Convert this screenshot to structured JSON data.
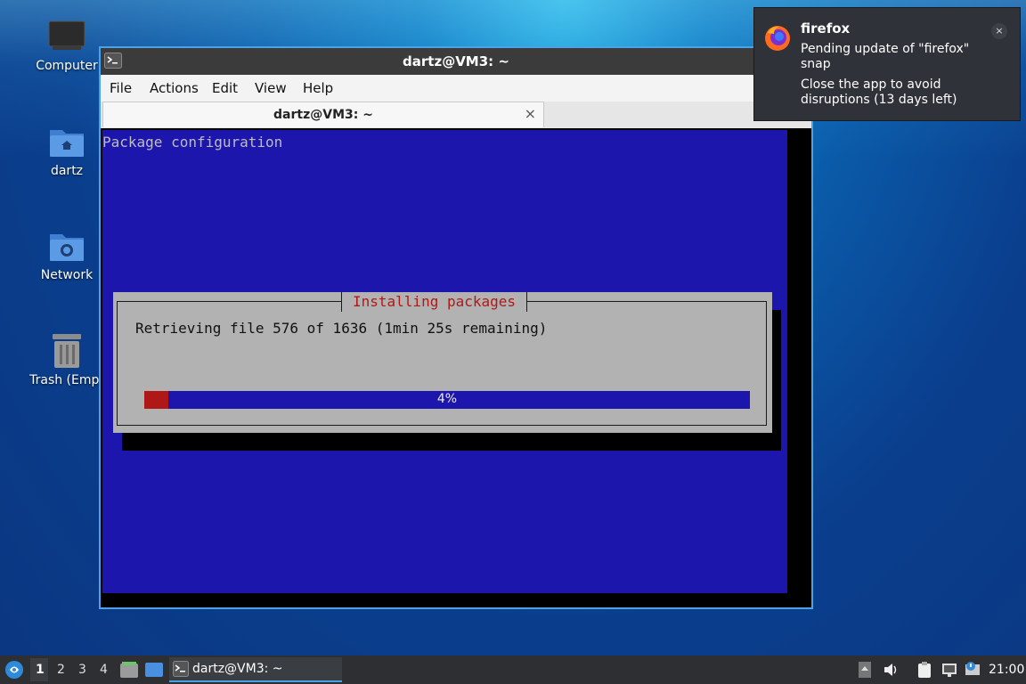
{
  "desktop": {
    "icons": [
      {
        "label": "Computer"
      },
      {
        "label": "dartz"
      },
      {
        "label": "Network"
      },
      {
        "label": "Trash (Empt"
      }
    ]
  },
  "window": {
    "title": "dartz@VM3: ~",
    "menu": [
      "File",
      "Actions",
      "Edit",
      "View",
      "Help"
    ],
    "tab": {
      "title": "dartz@VM3: ~",
      "close": "×"
    },
    "terminal": {
      "screen_title": "Package configuration",
      "dialog": {
        "title": "Installing packages",
        "message": "Retrieving file 576 of 1636 (1min 25s remaining)",
        "progress_label": "4%",
        "progress_fraction": 0.04
      }
    }
  },
  "notification": {
    "app": "firefox",
    "summary": "Pending update of \"firefox\" snap",
    "body": "Close the app to avoid disruptions (13 days left)",
    "close": "×"
  },
  "taskbar": {
    "workspaces": [
      "1",
      "2",
      "3",
      "4"
    ],
    "active_workspace": "1",
    "task_label": "dartz@VM3: ~",
    "clock": "21:00"
  },
  "colors": {
    "terminal_blue": "#1c16ad",
    "dialog_gray": "#b2b2b2",
    "dialog_title_red": "#b01818",
    "accent": "#4aa3e8"
  }
}
